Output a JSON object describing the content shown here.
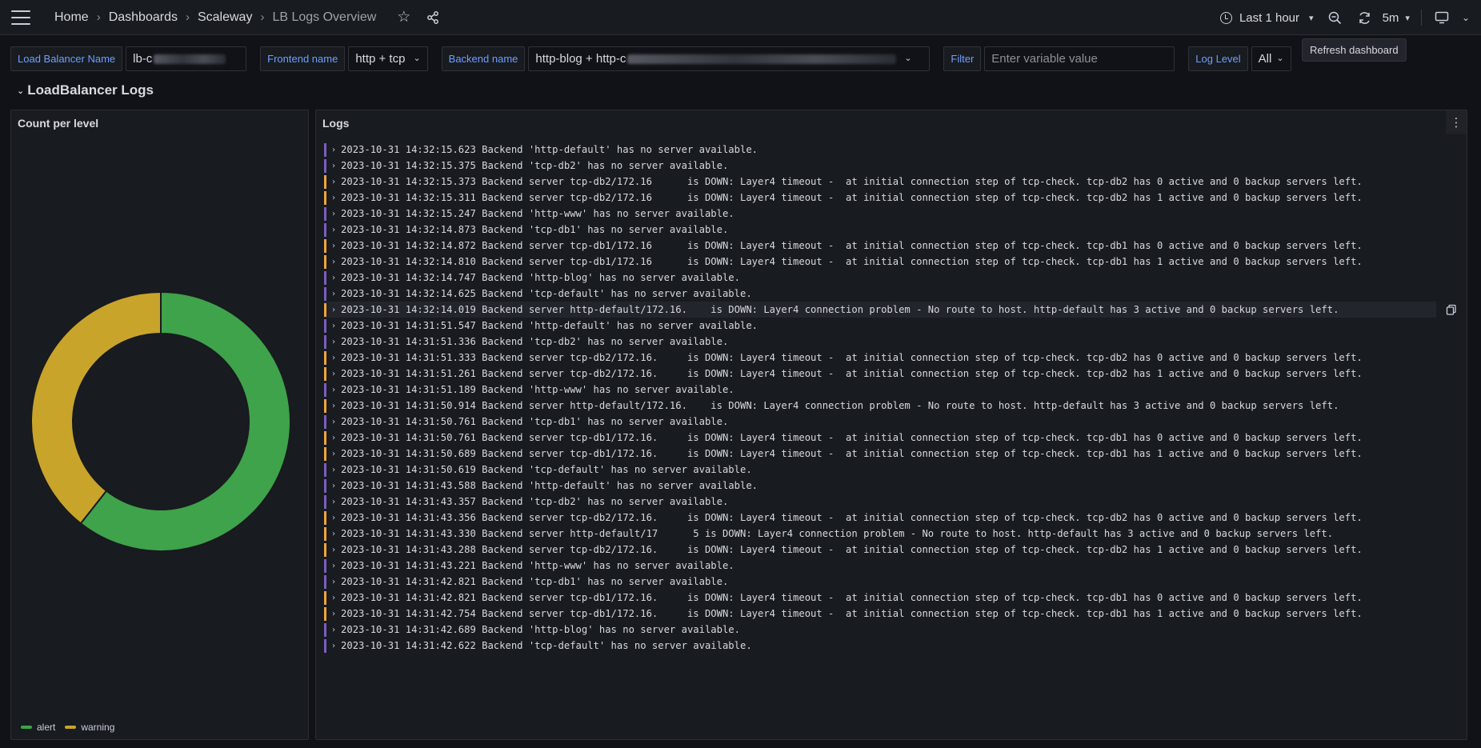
{
  "nav": {
    "breadcrumbs": [
      "Home",
      "Dashboards",
      "Scaleway",
      "LB Logs Overview"
    ],
    "time_range": "Last 1 hour",
    "refresh_interval": "5m",
    "tooltip": "Refresh dashboard"
  },
  "variables": {
    "load_balancer": {
      "label": "Load Balancer Name",
      "value": "lb-c"
    },
    "frontend": {
      "label": "Frontend name",
      "value": "http + tcp"
    },
    "backend": {
      "label": "Backend name",
      "value": "http-blog + http-c"
    },
    "filter": {
      "label": "Filter",
      "placeholder": "Enter variable value"
    },
    "log_level": {
      "label": "Log Level",
      "value": "All"
    }
  },
  "row": {
    "title": "LoadBalancer Logs"
  },
  "count_panel": {
    "title": "Count per level"
  },
  "logs_panel": {
    "title": "Logs"
  },
  "chart_data": {
    "type": "pie",
    "title": "Count per level",
    "categories": [
      "alert",
      "warning"
    ],
    "values": [
      20,
      13
    ],
    "colors": [
      "#3ea34a",
      "#c9a42a"
    ],
    "legend": "bottom-left"
  },
  "colors": {
    "info_bar": "#7c5cbf",
    "warning_bar": "#f2a33a"
  },
  "logs": [
    {
      "level": "info",
      "text": "2023-10-31 14:32:15.623 Backend 'http-default' has no server available."
    },
    {
      "level": "info",
      "text": "2023-10-31 14:32:15.375 Backend 'tcp-db2' has no server available."
    },
    {
      "level": "warn",
      "text": "2023-10-31 14:32:15.373 Backend server tcp-db2/172.16      is DOWN: Layer4 timeout -  at initial connection step of tcp-check. tcp-db2 has 0 active and 0 backup servers left."
    },
    {
      "level": "warn",
      "text": "2023-10-31 14:32:15.311 Backend server tcp-db2/172.16      is DOWN: Layer4 timeout -  at initial connection step of tcp-check. tcp-db2 has 1 active and 0 backup servers left."
    },
    {
      "level": "info",
      "text": "2023-10-31 14:32:15.247 Backend 'http-www' has no server available."
    },
    {
      "level": "info",
      "text": "2023-10-31 14:32:14.873 Backend 'tcp-db1' has no server available."
    },
    {
      "level": "warn",
      "text": "2023-10-31 14:32:14.872 Backend server tcp-db1/172.16      is DOWN: Layer4 timeout -  at initial connection step of tcp-check. tcp-db1 has 0 active and 0 backup servers left."
    },
    {
      "level": "warn",
      "text": "2023-10-31 14:32:14.810 Backend server tcp-db1/172.16      is DOWN: Layer4 timeout -  at initial connection step of tcp-check. tcp-db1 has 1 active and 0 backup servers left."
    },
    {
      "level": "info",
      "text": "2023-10-31 14:32:14.747 Backend 'http-blog' has no server available."
    },
    {
      "level": "info",
      "text": "2023-10-31 14:32:14.625 Backend 'tcp-default' has no server available."
    },
    {
      "level": "warn",
      "text": "2023-10-31 14:32:14.019 Backend server http-default/172.16.    is DOWN: Layer4 connection problem - No route to host. http-default has 3 active and 0 backup servers left.",
      "highlight": true
    },
    {
      "level": "info",
      "text": "2023-10-31 14:31:51.547 Backend 'http-default' has no server available."
    },
    {
      "level": "info",
      "text": "2023-10-31 14:31:51.336 Backend 'tcp-db2' has no server available."
    },
    {
      "level": "warn",
      "text": "2023-10-31 14:31:51.333 Backend server tcp-db2/172.16.     is DOWN: Layer4 timeout -  at initial connection step of tcp-check. tcp-db2 has 0 active and 0 backup servers left."
    },
    {
      "level": "warn",
      "text": "2023-10-31 14:31:51.261 Backend server tcp-db2/172.16.     is DOWN: Layer4 timeout -  at initial connection step of tcp-check. tcp-db2 has 1 active and 0 backup servers left."
    },
    {
      "level": "info",
      "text": "2023-10-31 14:31:51.189 Backend 'http-www' has no server available."
    },
    {
      "level": "warn",
      "text": "2023-10-31 14:31:50.914 Backend server http-default/172.16.    is DOWN: Layer4 connection problem - No route to host. http-default has 3 active and 0 backup servers left."
    },
    {
      "level": "info",
      "text": "2023-10-31 14:31:50.761 Backend 'tcp-db1' has no server available."
    },
    {
      "level": "warn",
      "text": "2023-10-31 14:31:50.761 Backend server tcp-db1/172.16.     is DOWN: Layer4 timeout -  at initial connection step of tcp-check. tcp-db1 has 0 active and 0 backup servers left."
    },
    {
      "level": "warn",
      "text": "2023-10-31 14:31:50.689 Backend server tcp-db1/172.16.     is DOWN: Layer4 timeout -  at initial connection step of tcp-check. tcp-db1 has 1 active and 0 backup servers left."
    },
    {
      "level": "info",
      "text": "2023-10-31 14:31:50.619 Backend 'tcp-default' has no server available."
    },
    {
      "level": "info",
      "text": "2023-10-31 14:31:43.588 Backend 'http-default' has no server available."
    },
    {
      "level": "info",
      "text": "2023-10-31 14:31:43.357 Backend 'tcp-db2' has no server available."
    },
    {
      "level": "warn",
      "text": "2023-10-31 14:31:43.356 Backend server tcp-db2/172.16.     is DOWN: Layer4 timeout -  at initial connection step of tcp-check. tcp-db2 has 0 active and 0 backup servers left."
    },
    {
      "level": "warn",
      "text": "2023-10-31 14:31:43.330 Backend server http-default/17      5 is DOWN: Layer4 connection problem - No route to host. http-default has 3 active and 0 backup servers left."
    },
    {
      "level": "warn",
      "text": "2023-10-31 14:31:43.288 Backend server tcp-db2/172.16.     is DOWN: Layer4 timeout -  at initial connection step of tcp-check. tcp-db2 has 1 active and 0 backup servers left."
    },
    {
      "level": "info",
      "text": "2023-10-31 14:31:43.221 Backend 'http-www' has no server available."
    },
    {
      "level": "info",
      "text": "2023-10-31 14:31:42.821 Backend 'tcp-db1' has no server available."
    },
    {
      "level": "warn",
      "text": "2023-10-31 14:31:42.821 Backend server tcp-db1/172.16.     is DOWN: Layer4 timeout -  at initial connection step of tcp-check. tcp-db1 has 0 active and 0 backup servers left."
    },
    {
      "level": "warn",
      "text": "2023-10-31 14:31:42.754 Backend server tcp-db1/172.16.     is DOWN: Layer4 timeout -  at initial connection step of tcp-check. tcp-db1 has 1 active and 0 backup servers left."
    },
    {
      "level": "info",
      "text": "2023-10-31 14:31:42.689 Backend 'http-blog' has no server available."
    },
    {
      "level": "info",
      "text": "2023-10-31 14:31:42.622 Backend 'tcp-default' has no server available."
    }
  ]
}
